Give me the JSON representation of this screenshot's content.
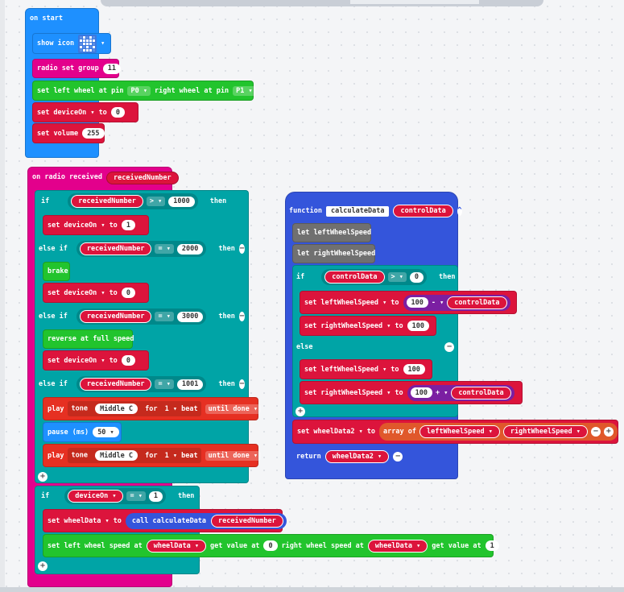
{
  "colors": {
    "events": "#1e90ff",
    "radio": "#e3008c",
    "logic": "#00a4a6",
    "variables": "#dc143c",
    "motors": "#22c42d",
    "music": "#e63022",
    "functions": "#3455db",
    "locals": "#707070"
  },
  "on_start": {
    "header": "on start",
    "show_icon": "show icon",
    "radio_set_group": "radio set group",
    "group_value": "11",
    "set_left_wheel": "set left wheel at pin",
    "left_pin": "P0",
    "right_wheel": "right wheel at pin",
    "right_pin": "P1",
    "set": "set",
    "var_deviceOn": "deviceOn",
    "to": "to",
    "zero": "0",
    "set_volume": "set volume",
    "volume": "255"
  },
  "on_radio": {
    "header": "on radio received",
    "param": "receivedNumber",
    "if": "if",
    "else_if": "else if",
    "else": "else",
    "then": "then",
    "op_gt": ">",
    "op_eq": "=",
    "v1000": "1000",
    "v2000": "2000",
    "v3000": "3000",
    "v1001": "1001",
    "one": "1",
    "zero": "0",
    "fifty": "50",
    "brake": "brake",
    "reverse": "reverse at full speed",
    "play": "play",
    "tone": "tone",
    "middle_c": "Middle C",
    "for": "for",
    "beat": "1 ▾ beat",
    "until_done": "until done",
    "pause": "pause (ms)",
    "var_deviceOn": "deviceOn",
    "var_wheelData": "wheelData",
    "set": "set",
    "to": "to",
    "call": "call calculateData",
    "set_left_speed": "set left wheel speed at",
    "get_value_at": "get value at",
    "right_speed": "right wheel speed at"
  },
  "function_block": {
    "header": "function",
    "name": "calculateData",
    "param": "controlData",
    "let_left": "let leftWheelSpeed",
    "let_right": "let rightWheelSpeed",
    "if": "if",
    "then": "then",
    "else": "else",
    "op_gt": ">",
    "op_minus": "-",
    "op_plus": "+",
    "zero": "0",
    "hundred": "100",
    "set": "set",
    "to": "to",
    "var_left": "leftWheelSpeed",
    "var_right": "rightWheelSpeed",
    "var_wheelData2": "wheelData2",
    "array_of": "array of",
    "return": "return"
  }
}
